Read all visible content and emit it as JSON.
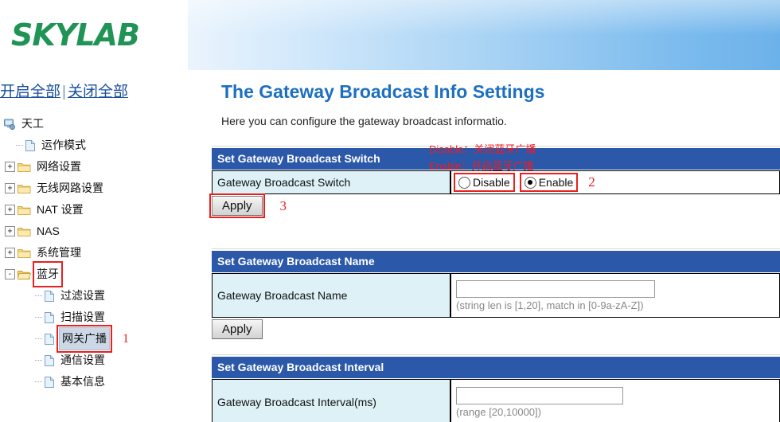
{
  "brand": {
    "logo_text": "SKYLAB",
    "logo_color": "#1f9455"
  },
  "sidebar": {
    "expand_all_label": "开启全部",
    "separator": "|",
    "collapse_all_label": "关闭全部",
    "tree": [
      {
        "label": "天工",
        "icon": "computer-icon",
        "depth": 0,
        "expander": "",
        "selected": false,
        "highlighted": false,
        "marker": ""
      },
      {
        "label": "运作模式",
        "icon": "page-icon",
        "depth": 1,
        "expander": "",
        "selected": false,
        "highlighted": false,
        "marker": ""
      },
      {
        "label": "网络设置",
        "icon": "folder-icon",
        "depth": 1,
        "expander": "+",
        "selected": false,
        "highlighted": false,
        "marker": ""
      },
      {
        "label": "无线网路设置",
        "icon": "folder-icon",
        "depth": 1,
        "expander": "+",
        "selected": false,
        "highlighted": false,
        "marker": ""
      },
      {
        "label": "NAT 设置",
        "icon": "folder-icon",
        "depth": 1,
        "expander": "+",
        "selected": false,
        "highlighted": false,
        "marker": ""
      },
      {
        "label": "NAS",
        "icon": "folder-icon",
        "depth": 1,
        "expander": "+",
        "selected": false,
        "highlighted": false,
        "marker": ""
      },
      {
        "label": "系统管理",
        "icon": "folder-icon",
        "depth": 1,
        "expander": "+",
        "selected": false,
        "highlighted": false,
        "marker": ""
      },
      {
        "label": "蓝牙",
        "icon": "folder-open-icon",
        "depth": 1,
        "expander": "-",
        "selected": false,
        "highlighted": true,
        "marker": ""
      },
      {
        "label": "过滤设置",
        "icon": "page-icon",
        "depth": 2,
        "expander": "",
        "selected": false,
        "highlighted": false,
        "marker": ""
      },
      {
        "label": "扫描设置",
        "icon": "page-icon",
        "depth": 2,
        "expander": "",
        "selected": false,
        "highlighted": false,
        "marker": ""
      },
      {
        "label": "网关广播",
        "icon": "page-icon",
        "depth": 2,
        "expander": "",
        "selected": true,
        "highlighted": true,
        "marker": "1"
      },
      {
        "label": "通信设置",
        "icon": "page-icon",
        "depth": 2,
        "expander": "",
        "selected": false,
        "highlighted": false,
        "marker": ""
      },
      {
        "label": "基本信息",
        "icon": "page-icon",
        "depth": 2,
        "expander": "",
        "selected": false,
        "highlighted": false,
        "marker": ""
      }
    ]
  },
  "main": {
    "title": "The Gateway Broadcast Info Settings",
    "subtitle": "Here you can configure the gateway broadcast informatio.",
    "sections": {
      "switch": {
        "header": "Set Gateway Broadcast Switch",
        "label": "Gateway Broadcast Switch",
        "options": [
          {
            "label": "Disable",
            "selected": false
          },
          {
            "label": "Enable",
            "selected": true
          }
        ],
        "apply_label": "Apply"
      },
      "name": {
        "header": "Set Gateway Broadcast Name",
        "label": "Gateway Broadcast Name",
        "value": "",
        "hint": "(string len is [1,20], match in [0-9a-zA-Z])",
        "apply_label": "Apply"
      },
      "interval": {
        "header": "Set Gateway Broadcast Interval",
        "label": "Gateway Broadcast Interval(ms)",
        "value": "",
        "hint": "(range [20,10000])"
      }
    }
  },
  "annotations": {
    "disable_note": "Disable：关闭蓝牙广播",
    "enable_note": "Enable：开启蓝牙广播",
    "marker_radio": "2",
    "marker_apply": "3",
    "marker_nav": "1",
    "color": "#ed1c24"
  }
}
